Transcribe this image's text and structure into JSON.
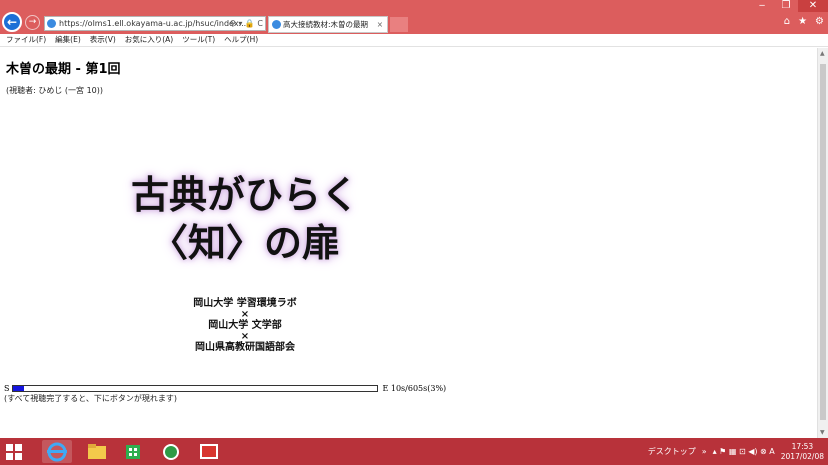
{
  "window": {
    "controls": [
      "‒",
      "❐",
      "✕"
    ]
  },
  "browser": {
    "address": "https://olms1.ell.okayama-u.ac.jp/hsuc/index...",
    "address_tools": "⚲ ▾ 🔒 C",
    "tab_title": "高大接続教材:木曽の最期",
    "tab_close": "×",
    "right_icons": [
      "⌂",
      "★",
      "⚙"
    ]
  },
  "menubar": {
    "items": [
      "ファイル(F)",
      "編集(E)",
      "表示(V)",
      "お気に入り(A)",
      "ツール(T)",
      "ヘルプ(H)"
    ]
  },
  "page": {
    "title": "木曽の最期 - 第1回",
    "viewer": "(視聴者: ひめじ (一宮 10))"
  },
  "video": {
    "slogan_line1": "古典がひらく",
    "slogan_line2": "〈知〉の扉",
    "credits": [
      "岡山大学 学習環境ラボ",
      "×",
      "岡山大学 文学部",
      "×",
      "岡山県高教研国語部会"
    ]
  },
  "progress": {
    "start_label": "S",
    "end_label": "E",
    "status": "10s/605s(3%)",
    "fraction": 0.03
  },
  "note": "(すべて視聴完了すると、下にボタンが現れます)",
  "taskbar": {
    "tray_desktop": "デスクトップ",
    "tray_chevron": "»",
    "tray_icons": "▴ ⚑ ▦ ⊡ ◀) ⊗ A",
    "time": "17:53",
    "date": "2017/02/08"
  },
  "colors": {
    "chrome": "#dc5d5d",
    "taskbar": "#b8323a",
    "progress": "#1515e0"
  }
}
